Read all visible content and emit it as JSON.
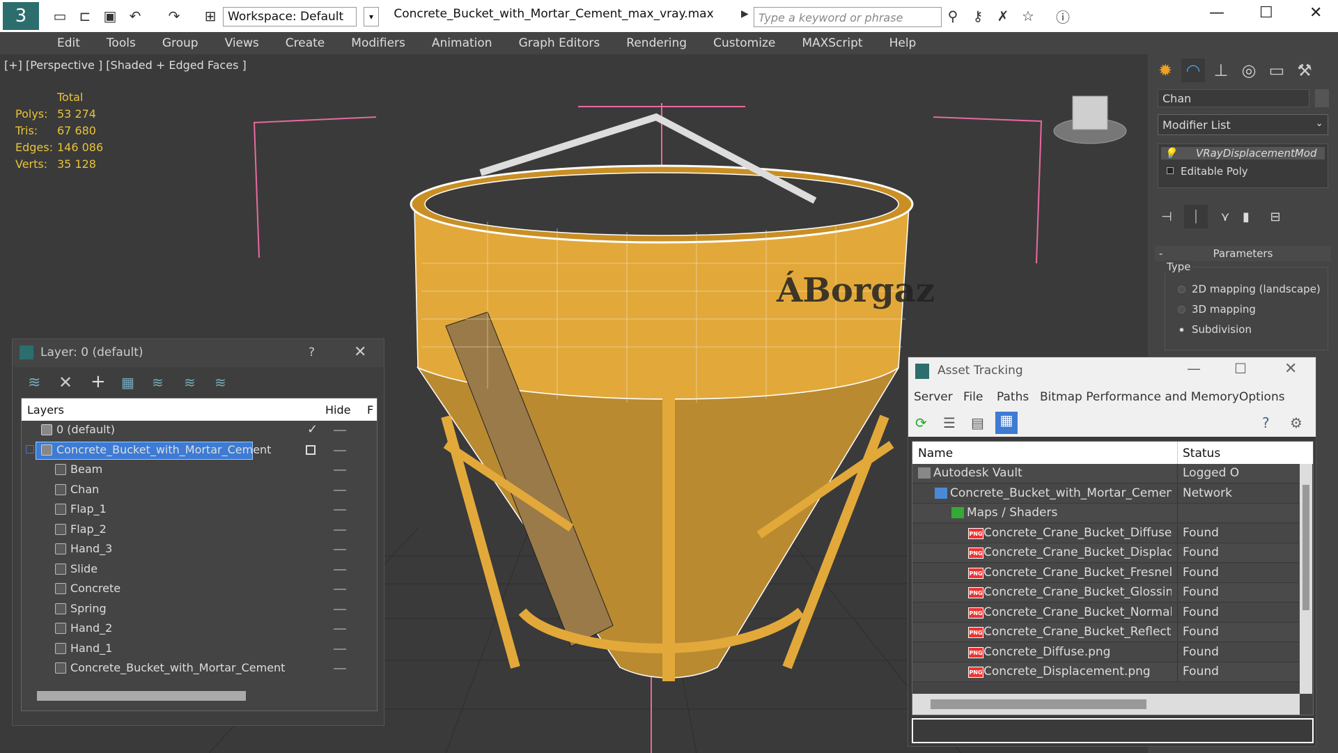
{
  "app": {
    "title": "Concrete_Bucket_with_Mortar_Cement_max_vray.max",
    "workspace": "Workspace: Default",
    "search_placeholder": "Type a keyword or phrase"
  },
  "menu": [
    "Edit",
    "Tools",
    "Group",
    "Views",
    "Create",
    "Modifiers",
    "Animation",
    "Graph Editors",
    "Rendering",
    "Customize",
    "MAXScript",
    "Help"
  ],
  "viewport": {
    "label": "[+] [Perspective ] [Shaded + Edged Faces ]",
    "stats": {
      "header": "Total",
      "rows": [
        {
          "label": "Polys:",
          "value": "53 274"
        },
        {
          "label": "Tris:",
          "value": "67 680"
        },
        {
          "label": "Edges:",
          "value": "146 086"
        },
        {
          "label": "Verts:",
          "value": "35 128"
        }
      ]
    }
  },
  "command_panel": {
    "object_name": "Chan",
    "modifier_list": "Modifier List",
    "stack": [
      "VRayDisplacementMod",
      "Editable Poly"
    ],
    "params_title": "Parameters",
    "type_label": "Type",
    "options": [
      "2D mapping (landscape)",
      "3D mapping",
      "Subdivision"
    ],
    "selected_option": "Subdivision"
  },
  "layer_panel": {
    "title": "Layer: 0 (default)",
    "help": "?",
    "col_layers": "Layers",
    "col_hide": "Hide",
    "col_extra": "F",
    "layers": [
      {
        "name": "0 (default)",
        "kind": "layer",
        "level": 0
      },
      {
        "name": "Concrete_Bucket_with_Mortar_Cement",
        "kind": "layer",
        "level": 0,
        "selected": true
      },
      {
        "name": "Beam",
        "kind": "object",
        "level": 1
      },
      {
        "name": "Chan",
        "kind": "object",
        "level": 1
      },
      {
        "name": "Flap_1",
        "kind": "object",
        "level": 1
      },
      {
        "name": "Flap_2",
        "kind": "object",
        "level": 1
      },
      {
        "name": "Hand_3",
        "kind": "object",
        "level": 1
      },
      {
        "name": "Slide",
        "kind": "object",
        "level": 1
      },
      {
        "name": "Concrete",
        "kind": "object",
        "level": 1
      },
      {
        "name": "Spring",
        "kind": "object",
        "level": 1
      },
      {
        "name": "Hand_2",
        "kind": "object",
        "level": 1
      },
      {
        "name": "Hand_1",
        "kind": "object",
        "level": 1
      },
      {
        "name": "Concrete_Bucket_with_Mortar_Cement",
        "kind": "object",
        "level": 1
      }
    ]
  },
  "asset_panel": {
    "title": "Asset Tracking",
    "menu": [
      "Server",
      "File",
      "Paths",
      "Bitmap Performance and Memory",
      "Options"
    ],
    "col_name": "Name",
    "col_status": "Status",
    "rows": [
      {
        "name": "Autodesk Vault",
        "status": "Logged O",
        "level": 0,
        "icon": "vault-icon"
      },
      {
        "name": "Concrete_Bucket_with_Mortar_Cement_max_vr...",
        "status": "Network",
        "level": 1,
        "icon": "max-file-icon"
      },
      {
        "name": "Maps / Shaders",
        "status": "",
        "level": 2,
        "icon": "maps-icon"
      },
      {
        "name": "Concrete_Crane_Bucket_Diffuse.png",
        "status": "Found",
        "level": 3,
        "icon": "png-icon"
      },
      {
        "name": "Concrete_Crane_Bucket_Displacement.png",
        "status": "Found",
        "level": 3,
        "icon": "png-icon"
      },
      {
        "name": "Concrete_Crane_Bucket_Fresnel_Ior.png",
        "status": "Found",
        "level": 3,
        "icon": "png-icon"
      },
      {
        "name": "Concrete_Crane_Bucket_Glossiness.png",
        "status": "Found",
        "level": 3,
        "icon": "png-icon"
      },
      {
        "name": "Concrete_Crane_Bucket_Normal.png",
        "status": "Found",
        "level": 3,
        "icon": "png-icon"
      },
      {
        "name": "Concrete_Crane_Bucket_Reflection.png",
        "status": "Found",
        "level": 3,
        "icon": "png-icon"
      },
      {
        "name": "Concrete_Diffuse.png",
        "status": "Found",
        "level": 3,
        "icon": "png-icon"
      },
      {
        "name": "Concrete_Displacement.png",
        "status": "Found",
        "level": 3,
        "icon": "png-icon"
      }
    ]
  },
  "colors": {
    "accent": "#3d7bd4",
    "stats": "#e8c33a",
    "bucket": "#e2a93a",
    "frame": "#e86aa0"
  }
}
